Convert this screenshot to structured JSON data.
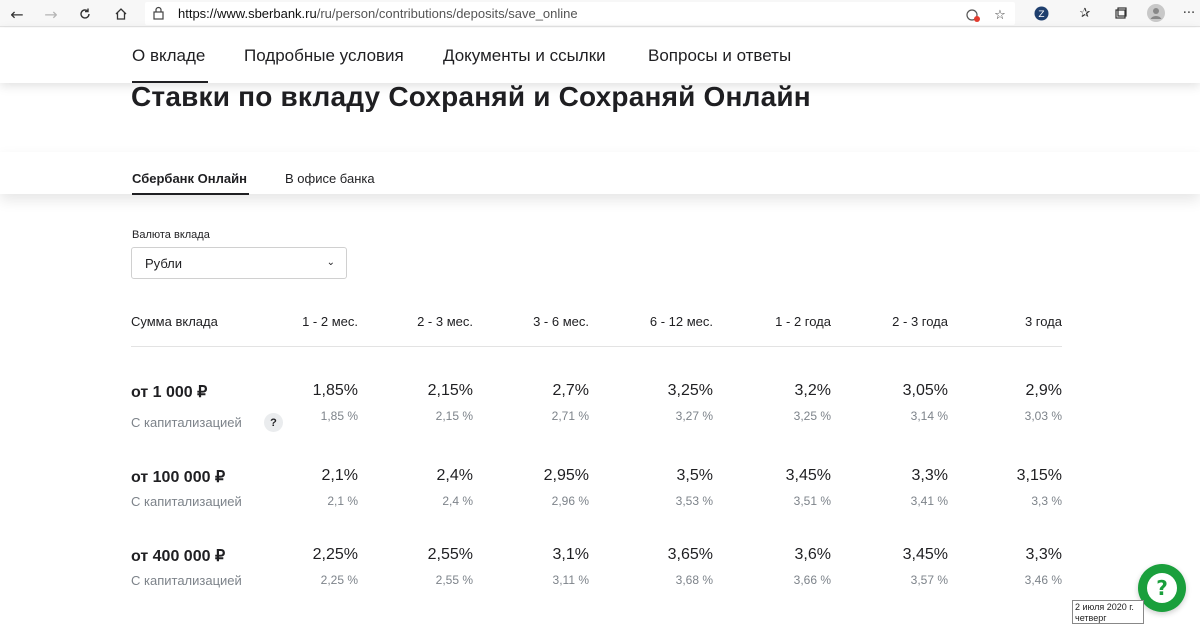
{
  "browser": {
    "url_domain": "https://www.sberbank.ru",
    "url_path": "/ru/person/contributions/deposits/save_online"
  },
  "top_nav": [
    "О вкладе",
    "Подробные условия",
    "Документы и ссылки",
    "Вопросы и ответы"
  ],
  "page_title": "Ставки по вкладу Сохраняй и Сохраняй Онлайн",
  "subtabs": [
    "Сбербанк Онлайн",
    "В офисе банка"
  ],
  "currency": {
    "label": "Валюта вклада",
    "value": "Рубли"
  },
  "table": {
    "amount_header": "Сумма вклада",
    "terms": [
      "1 - 2 мес.",
      "2 - 3 мес.",
      "3 - 6 мес.",
      "6 - 12 мес.",
      "1 - 2 года",
      "2 - 3 года",
      "3 года"
    ],
    "rows": [
      {
        "amount": "от 1 000 ₽",
        "cap_label": "С капитализацией",
        "rates": [
          "1,85%",
          "2,15%",
          "2,7%",
          "3,25%",
          "3,2%",
          "3,05%",
          "2,9%"
        ],
        "cap_rates": [
          "1,85 %",
          "2,15 %",
          "2,71 %",
          "3,27 %",
          "3,25 %",
          "3,14 %",
          "3,03 %"
        ]
      },
      {
        "amount": "от 100 000 ₽",
        "cap_label": "С капитализацией",
        "rates": [
          "2,1%",
          "2,4%",
          "2,95%",
          "3,5%",
          "3,45%",
          "3,3%",
          "3,15%"
        ],
        "cap_rates": [
          "2,1 %",
          "2,4 %",
          "2,96 %",
          "3,53 %",
          "3,51 %",
          "3,41 %",
          "3,3 %"
        ]
      },
      {
        "amount": "от 400 000 ₽",
        "cap_label": "С капитализацией",
        "rates": [
          "2,25%",
          "2,55%",
          "3,1%",
          "3,65%",
          "3,6%",
          "3,45%",
          "3,3%"
        ],
        "cap_rates": [
          "2,25 %",
          "2,55 %",
          "3,11 %",
          "3,68 %",
          "3,66 %",
          "3,57 %",
          "3,46 %"
        ]
      }
    ],
    "help_label": "?"
  },
  "chat_icon": "?",
  "datetime": {
    "date": "2 июля 2020 г.",
    "weekday": "четверг"
  }
}
